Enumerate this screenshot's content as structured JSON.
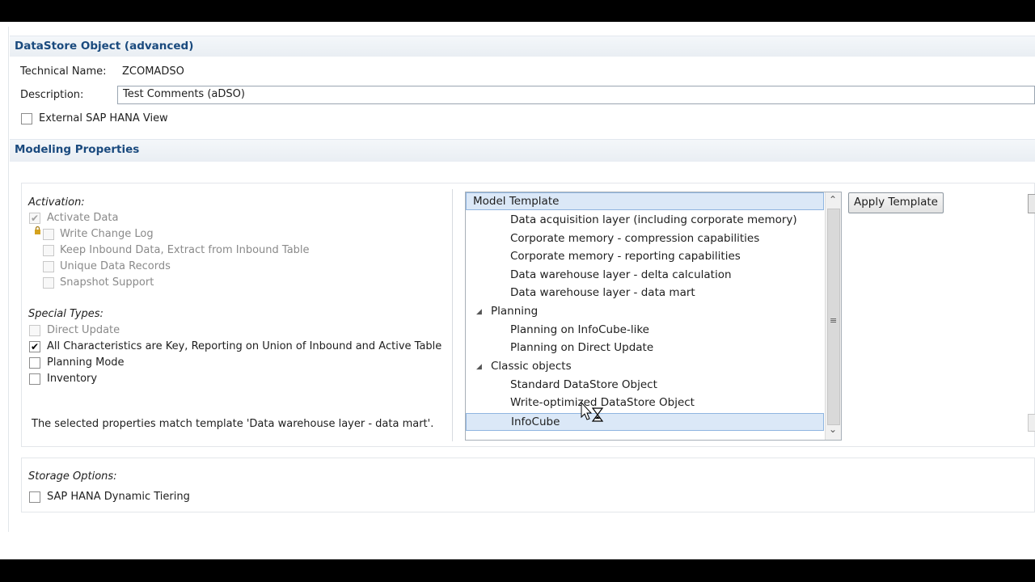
{
  "section_datastore": {
    "title": "DataStore Object (advanced)"
  },
  "general": {
    "technical_name_label": "Technical Name:",
    "technical_name_value": "ZCOMADSO",
    "description_label": "Description:",
    "description_value": "Test Comments (aDSO)",
    "external_hana_view_label": "External SAP HANA View"
  },
  "section_modeling": {
    "title": "Modeling Properties"
  },
  "activation": {
    "heading": "Activation:",
    "activate_data": "Activate Data",
    "write_change_log": "Write Change Log",
    "keep_inbound": "Keep Inbound Data, Extract from Inbound Table",
    "unique_records": "Unique Data Records",
    "snapshot_support": "Snapshot Support"
  },
  "special_types": {
    "heading": "Special Types:",
    "direct_update": "Direct Update",
    "all_characteristics": "All Characteristics are Key, Reporting on Union of Inbound and Active Table",
    "planning_mode": "Planning Mode",
    "inventory": "Inventory"
  },
  "template_match_message": "The selected properties match template 'Data warehouse layer - data mart'.",
  "template_list": {
    "items": [
      {
        "label": "Model Template",
        "indent": 0,
        "group": false
      },
      {
        "label": "Data acquisition layer (including corporate memory)",
        "indent": 2,
        "group": false
      },
      {
        "label": "Corporate memory - compression capabilities",
        "indent": 2,
        "group": false
      },
      {
        "label": "Corporate memory - reporting capabilities",
        "indent": 2,
        "group": false
      },
      {
        "label": "Data warehouse layer - delta calculation",
        "indent": 2,
        "group": false
      },
      {
        "label": "Data warehouse layer - data mart",
        "indent": 2,
        "group": false
      },
      {
        "label": "Planning",
        "indent": 1,
        "group": true
      },
      {
        "label": "Planning on InfoCube-like",
        "indent": 2,
        "group": false
      },
      {
        "label": "Planning on Direct Update",
        "indent": 2,
        "group": false
      },
      {
        "label": "Classic objects",
        "indent": 1,
        "group": true
      },
      {
        "label": "Standard DataStore Object",
        "indent": 2,
        "group": false
      },
      {
        "label": "Write-optimized DataStore Object",
        "indent": 2,
        "group": false
      },
      {
        "label": "InfoCube",
        "indent": 2,
        "group": false
      }
    ]
  },
  "apply_template_button": "Apply Template",
  "storage": {
    "heading": "Storage Options:",
    "dynamic_tiering": "SAP HANA Dynamic Tiering"
  },
  "icons": {
    "check": "✔",
    "expanded_triangle": "◢",
    "scroll_up": "⌃",
    "scroll_down": "⌄",
    "scroll_grip": "≡",
    "lock": "🔒"
  }
}
